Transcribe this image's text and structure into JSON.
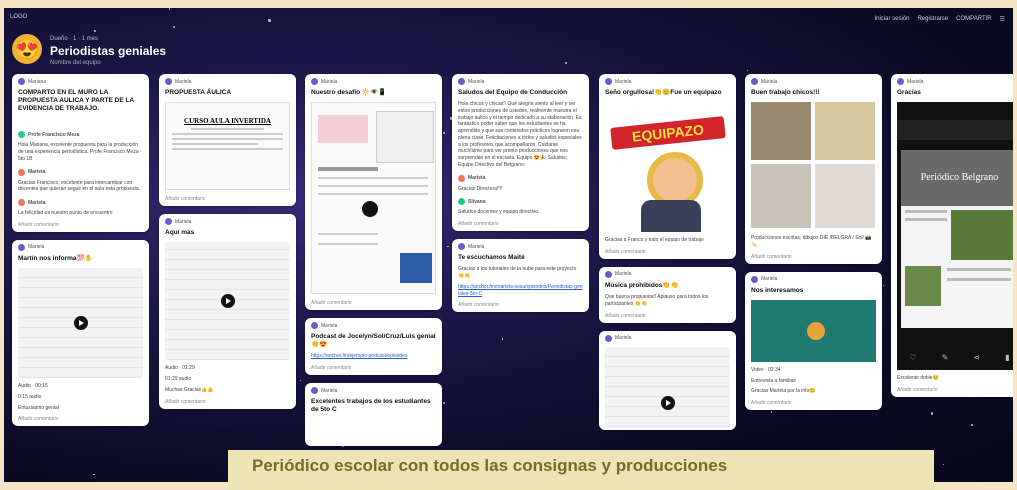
{
  "topbar": {
    "left": "LOGO",
    "right": [
      "Iniciar sesión",
      "Registrarse",
      "COMPARTIR"
    ]
  },
  "board": {
    "meta": "Dueño · 1 · 1 mes",
    "title": "Periodistas geniales",
    "subtitle": "Nombre del equipo"
  },
  "cards": [
    {
      "col": 0,
      "author": "Mariana",
      "title": "COMPARTO EN EL MURO LA PROPUESTA AULICA Y PARTE DE LA EVIDENCIA DE TRABAJO.",
      "body": "",
      "comments": [
        {
          "author": "Profe Francisco Meza",
          "text": "Hola Mariana, excelente propuesta para la producción de una experiencia periodística. Profe Francisco Meza - 5to 1B"
        },
        {
          "author": "Marieta",
          "text": "Gracias Francisco, excelente para intercambiar con docentes que quieran seguir en el aula esta propuesta."
        },
        {
          "author": "Marieta",
          "text": "La felicidad es nuestro punto de encuentro"
        }
      ],
      "footer": "Añadir comentario"
    },
    {
      "col": 0,
      "author": "Mariela",
      "title": "Martín nos informa💯✋",
      "media": "audio",
      "caption": "Audio · 00:15",
      "sub": "0:15 audio",
      "extra": "Entusiasmo genial",
      "footer": "Añadir comentario"
    },
    {
      "col": 1,
      "author": "Mariela",
      "title": "PROPUESTA ÁULICA",
      "doc_title": "CURSO AULA INVERTIDA",
      "footer": "Añadir comentario"
    },
    {
      "col": 1,
      "author": "Mariela",
      "title": "Aquí más",
      "media": "audio",
      "caption": "Audio · 01:29",
      "sub": "01:29 audio",
      "extra": "Muchas Gracias👍👍",
      "footer": "Añadir comentario"
    },
    {
      "col": 2,
      "author": "Mariela",
      "title": "Nuestro desafío 🔆👁️📱",
      "footer": "Añadir comentario"
    },
    {
      "col": 2,
      "author": "Mariela",
      "title": "Podcast de Jocelyn/Sol/Cruz/Luis genial 👏😍",
      "body": "https://anchor.fm/ejemplo-podcast/episodes",
      "footer": "Añadir comentario"
    },
    {
      "col": 2,
      "author": "Mariela",
      "title": "Excelentes trabajos de los estudiantes de 5to C",
      "footer": ""
    },
    {
      "col": 3,
      "author": "Mariela",
      "title": "Saludos del Equipo de Conducción",
      "body": "Hola chicos y chicas!! Qué alegría siento al leer y ver estos producciones de ustedes, realmente muestra el trabajo áulico y el tiempo dedicado a su elaboración. Es fantástico poder saber que los estudiantes se ha aprendido y que sus contenidos prácticos lograron esa plena clase. Felicitaciones a todos y saludos especiales a los profesores que acompañaron. Cuidarse muchísimo para ver pronto producciones que nos sorprendan en el escuela. Equipo 😍🎉 Saludos, Equipo Directivo del Belgrano.",
      "comments": [
        {
          "author": "Marieta",
          "text": "Gracias Directora!!!!"
        },
        {
          "author": "Silvana",
          "text": "Saludos docentes y equipo directivo."
        }
      ],
      "footer": "Añadir comentario"
    },
    {
      "col": 3,
      "author": "Mariela",
      "title": "Te escuchamos Maité",
      "body": "Gracias a los tutoriales de la nube para este proyecto 👏👏",
      "link": "https://anchor.fm/mariela-sosa/episodes/Periodistas-geniales-5to-C",
      "footer": "Añadir comentario"
    },
    {
      "col": 4,
      "author": "Mariela",
      "title": "Seño orgullosa!👏😊Fue un equipazo",
      "banner": "EQUIPAZO",
      "body": "Gracias a Franco y todo el equipo de trabajo",
      "footer": "Añadir comentario"
    },
    {
      "col": 4,
      "author": "Mariela",
      "title": "Música prohibidos👏👏",
      "body": "Que buena propuesta!! Aplauso para todos los participantes 👏👏",
      "footer": "Añadir comentario"
    },
    {
      "col": 4,
      "author": "Mariela",
      "title": "",
      "media": "audio",
      "footer": ""
    },
    {
      "col": 5,
      "author": "Mariela",
      "title": "Buen trabajo chicos!!!",
      "body": "Producciones escritas, dibujos DIE /BELGRA / Sol/ 📸🏷️",
      "footer": "Añadir comentario"
    },
    {
      "col": 5,
      "author": "Mariela",
      "title": "Nos interesamos",
      "media": "video",
      "caption": "Video · 02:34",
      "body": "Entrevista a familias",
      "extra": "Gracias Mariela por la info😊",
      "footer": "Añadir comentario"
    },
    {
      "col": 6,
      "author": "Mariela",
      "title": "Gracias",
      "newspaper": "Periódico Belgrano",
      "body": "Excelente doble😊",
      "footer": "Añadir comentario"
    }
  ],
  "caption": "Periódico escolar con todos las consignas y producciones",
  "colors": {
    "accent": "#6b5bd1",
    "banner": "#d0262b",
    "card": "#ffffff",
    "background": "#0c0b26"
  }
}
